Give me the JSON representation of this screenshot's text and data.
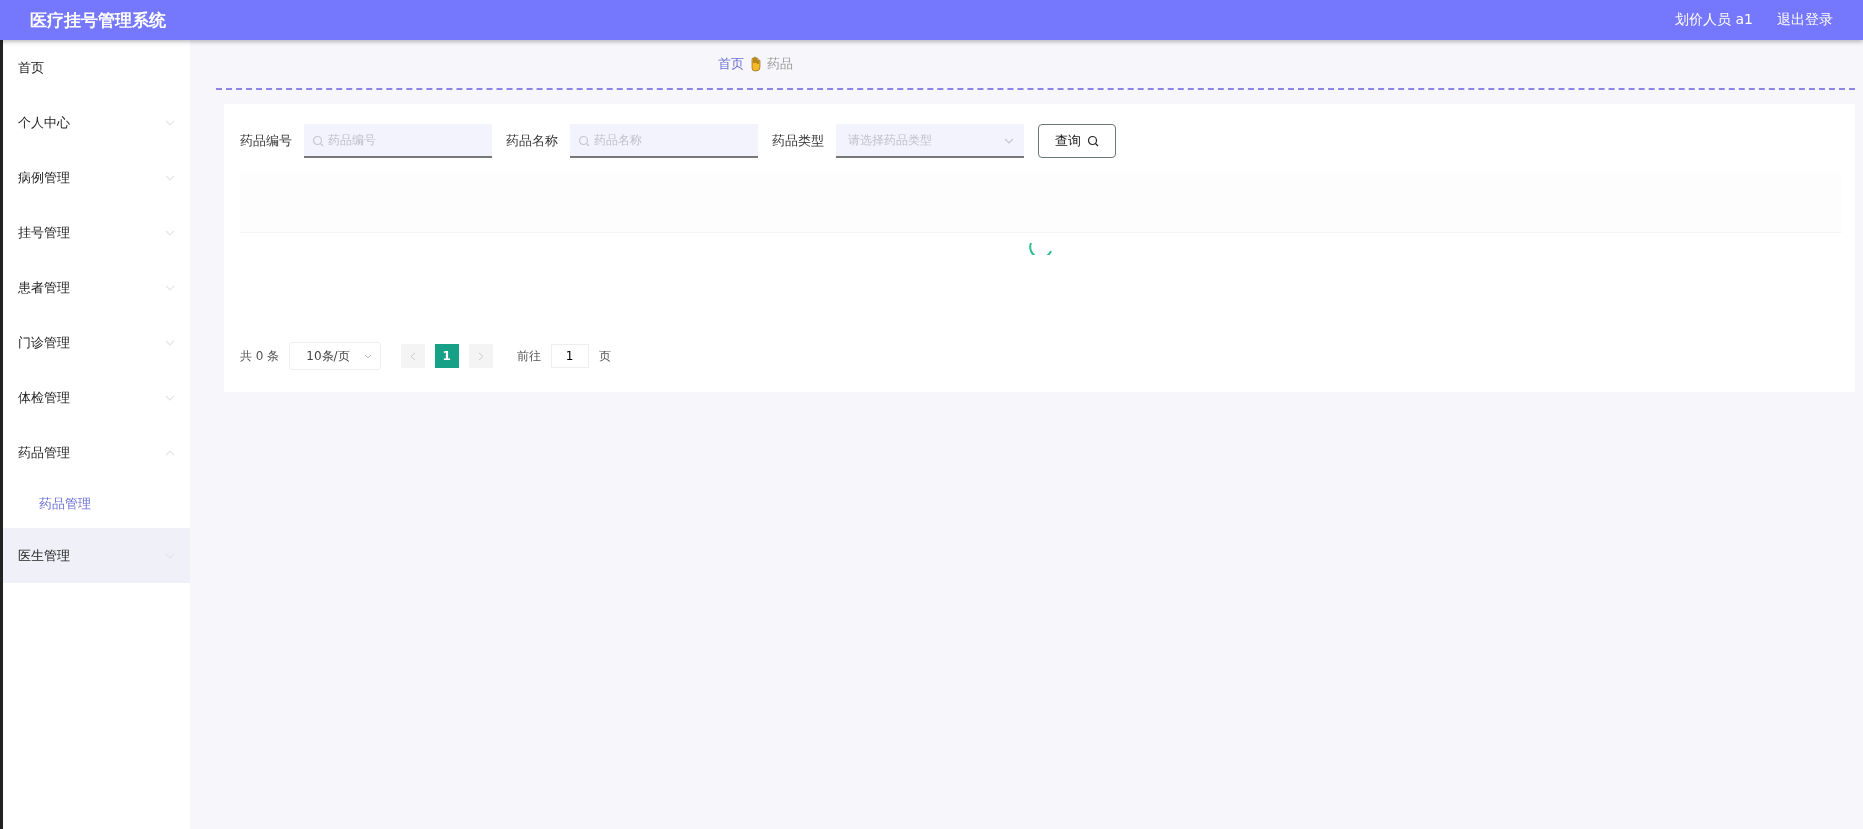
{
  "header": {
    "title": "医疗挂号管理系统",
    "user": "划价人员 a1",
    "logout": "退出登录"
  },
  "sidebar": {
    "items": [
      {
        "label": "首页",
        "has_children": false,
        "expanded": false,
        "hovered": false
      },
      {
        "label": "个人中心",
        "has_children": true,
        "expanded": false,
        "hovered": false
      },
      {
        "label": "病例管理",
        "has_children": true,
        "expanded": false,
        "hovered": false
      },
      {
        "label": "挂号管理",
        "has_children": true,
        "expanded": false,
        "hovered": false
      },
      {
        "label": "患者管理",
        "has_children": true,
        "expanded": false,
        "hovered": false
      },
      {
        "label": "门诊管理",
        "has_children": true,
        "expanded": false,
        "hovered": false
      },
      {
        "label": "体检管理",
        "has_children": true,
        "expanded": false,
        "hovered": false
      },
      {
        "label": "药品管理",
        "has_children": true,
        "expanded": true,
        "hovered": false,
        "children": [
          {
            "label": "药品管理",
            "selected": true
          }
        ]
      },
      {
        "label": "医生管理",
        "has_children": true,
        "expanded": false,
        "hovered": true
      }
    ]
  },
  "breadcrumb": [
    {
      "label": "首页",
      "current": false
    },
    {
      "label": "药品",
      "current": true
    }
  ],
  "filters": [
    {
      "kind": "input",
      "label": "药品编号",
      "placeholder": "药品编号"
    },
    {
      "kind": "input",
      "label": "药品名称",
      "placeholder": "药品名称"
    },
    {
      "kind": "select",
      "label": "药品类型",
      "placeholder": "请选择药品类型"
    }
  ],
  "query_button": "查询",
  "table": {
    "loading": true
  },
  "pagination": {
    "total": "共 0 条",
    "page_size": "10条/页",
    "pages": [
      {
        "label": "1",
        "selected": true
      }
    ],
    "goto_label": "前往",
    "goto_value": "1",
    "goto_suffix": "页"
  }
}
